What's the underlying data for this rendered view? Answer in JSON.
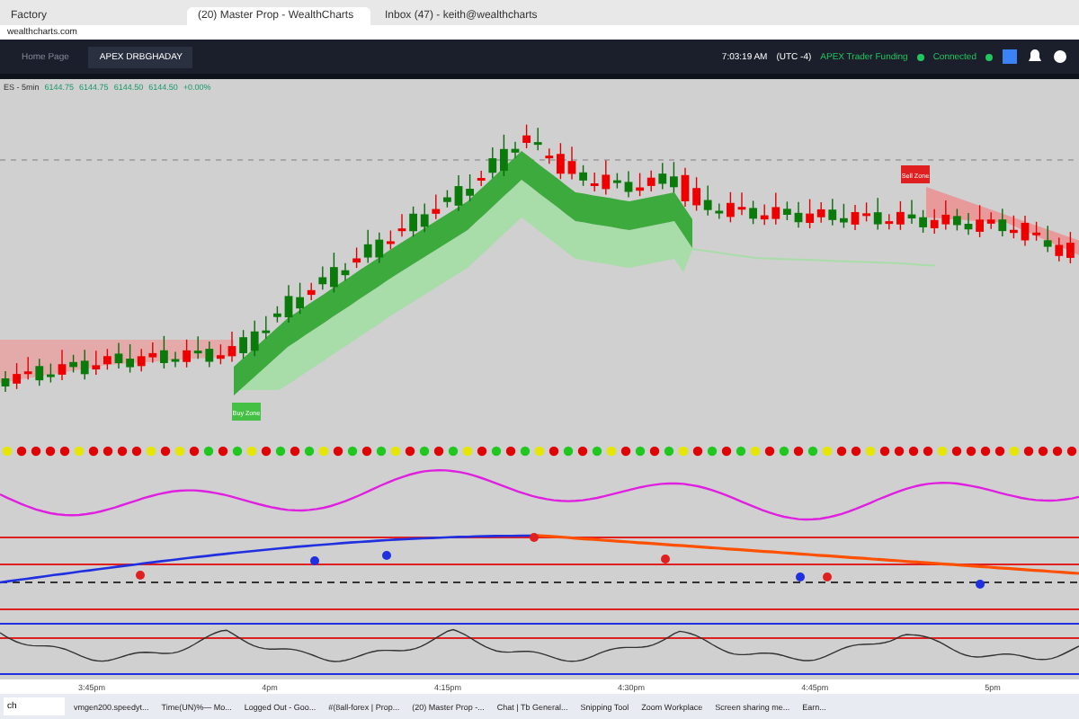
{
  "browser": {
    "tabs": [
      {
        "label": "Factory",
        "selected": false
      },
      {
        "label": "(20) Master Prop - WealthCharts",
        "selected": true
      },
      {
        "label": "Inbox (47) - keith@wealthcharts",
        "selected": false
      }
    ],
    "url": "wealthcharts.com"
  },
  "app": {
    "tabs": [
      {
        "label": "Home Page",
        "selected": false
      },
      {
        "label": "APEX DRBGHADAY",
        "selected": true
      }
    ],
    "time": "7:03:19 AM",
    "timezone": "(UTC -4)",
    "status": [
      {
        "label": "APEX Trader Funding",
        "color": "#22c55e"
      },
      {
        "label": "Connected",
        "color": "#22c55e"
      }
    ]
  },
  "symbol_bar": {
    "symbol": "ES - 5min",
    "values": [
      "6144.75",
      "6144.75",
      "6144.50",
      "6144.50",
      "+0.00%"
    ]
  },
  "chart": {
    "signals": [
      {
        "label": "Buy Zone",
        "kind": "buy"
      },
      {
        "label": "Sell Zone",
        "kind": "sell"
      }
    ]
  },
  "time_axis": [
    "3:45pm",
    "4pm",
    "4:15pm",
    "4:30pm",
    "4:45pm",
    "5pm"
  ],
  "taskbar": {
    "search": "ch",
    "items": [
      "vmgen200.speedyt...",
      "Time(UN)%— Mo...",
      "Logged Out - Goo...",
      "#(8all-forex | Prop...",
      "(20) Master Prop -...",
      "Chat | Tb General...",
      "Snipping Tool",
      "Zoom Workplace",
      "Screen sharing me...",
      "Earn..."
    ]
  }
}
